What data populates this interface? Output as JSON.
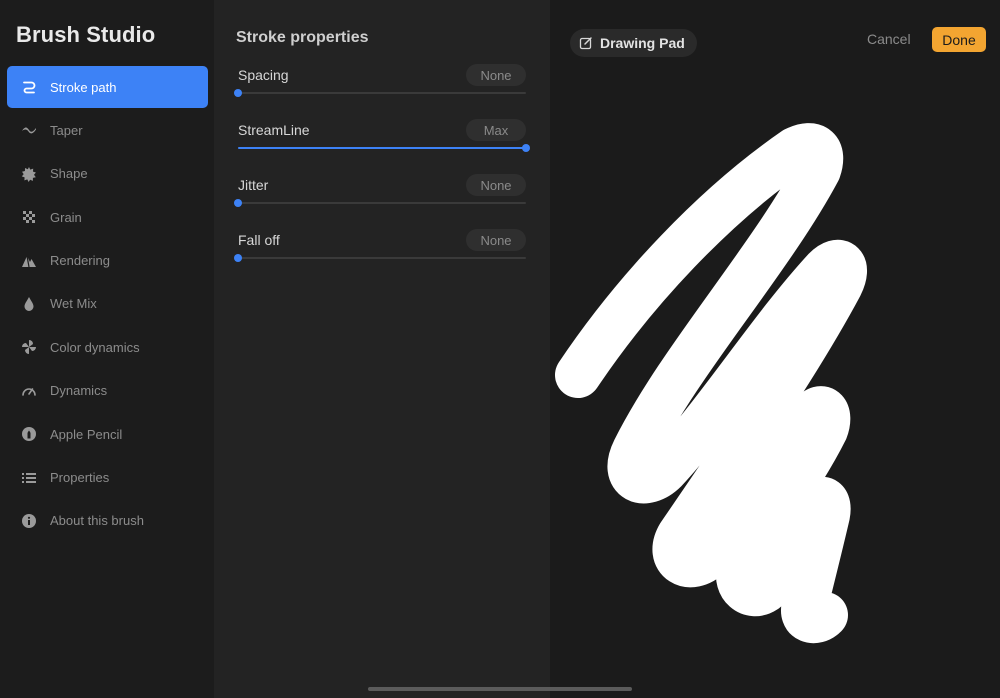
{
  "sidebar": {
    "title": "Brush Studio",
    "items": [
      {
        "label": "Stroke path",
        "icon": "stroke-path-icon",
        "active": true
      },
      {
        "label": "Taper",
        "icon": "taper-icon",
        "active": false
      },
      {
        "label": "Shape",
        "icon": "shape-icon",
        "active": false
      },
      {
        "label": "Grain",
        "icon": "grain-icon",
        "active": false
      },
      {
        "label": "Rendering",
        "icon": "rendering-icon",
        "active": false
      },
      {
        "label": "Wet Mix",
        "icon": "wet-mix-icon",
        "active": false
      },
      {
        "label": "Color dynamics",
        "icon": "color-dynamics-icon",
        "active": false
      },
      {
        "label": "Dynamics",
        "icon": "dynamics-icon",
        "active": false
      },
      {
        "label": "Apple Pencil",
        "icon": "apple-pencil-icon",
        "active": false
      },
      {
        "label": "Properties",
        "icon": "properties-icon",
        "active": false
      },
      {
        "label": "About this brush",
        "icon": "info-icon",
        "active": false
      }
    ]
  },
  "panel": {
    "title": "Stroke properties",
    "properties": [
      {
        "label": "Spacing",
        "value": "None",
        "level": 0
      },
      {
        "label": "StreamLine",
        "value": "Max",
        "level": 1
      },
      {
        "label": "Jitter",
        "value": "None",
        "level": 0
      },
      {
        "label": "Fall off",
        "value": "None",
        "level": 0
      }
    ]
  },
  "pad": {
    "title": "Drawing Pad",
    "cancel_label": "Cancel",
    "done_label": "Done"
  },
  "colors": {
    "accent": "#3d82f6",
    "done": "#f3a531",
    "sidebar_bg": "#1c1c1c",
    "panel_bg": "#232323",
    "pad_bg": "#1b1b1b",
    "stroke": "#ffffff"
  }
}
